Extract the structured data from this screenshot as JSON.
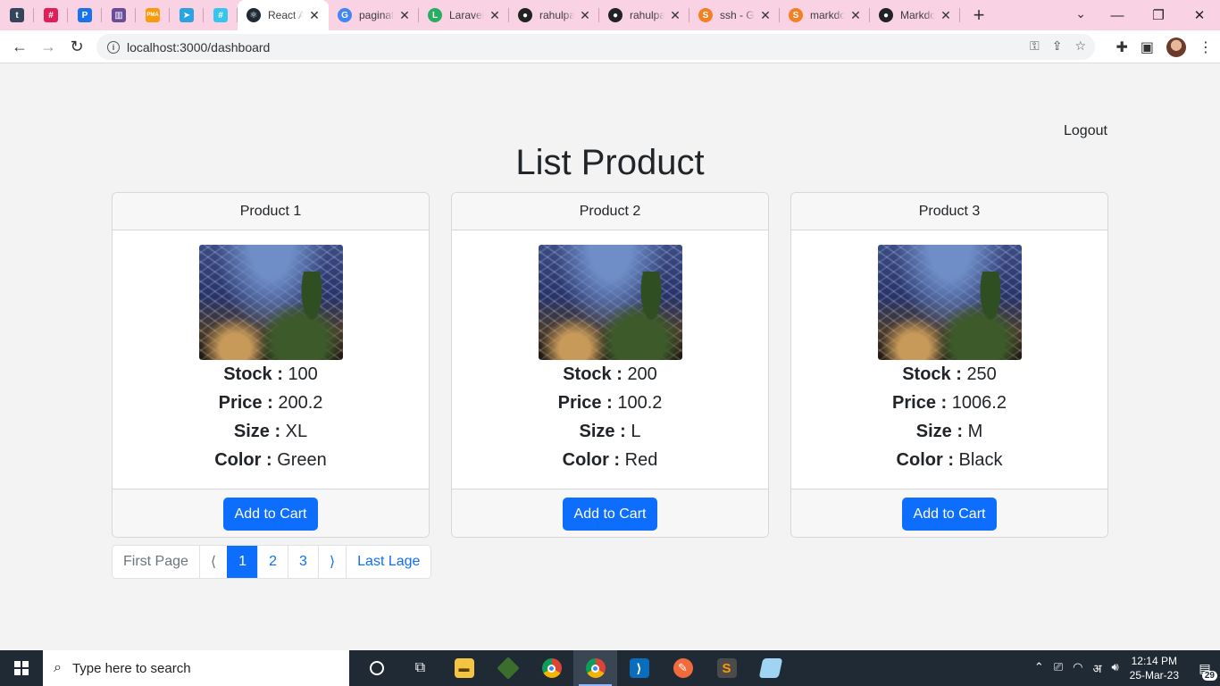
{
  "browser": {
    "pinned_tabs": [
      {
        "icon": "tumblr-icon",
        "glyph": "t",
        "color": "#35465c"
      },
      {
        "icon": "slack-icon",
        "glyph": "#",
        "color": "#e01e5a"
      },
      {
        "icon": "pocket-icon",
        "glyph": "P",
        "color": "#1a73e8"
      },
      {
        "icon": "trello-icon",
        "glyph": "▥",
        "color": "#6b4c9a"
      },
      {
        "icon": "phpmyadmin-icon",
        "glyph": "PMA",
        "color": "#f89c0e"
      },
      {
        "icon": "telegram-icon",
        "glyph": "➤",
        "color": "#2aa3e0"
      },
      {
        "icon": "slack-icon",
        "glyph": "#",
        "color": "#36c5f0"
      }
    ],
    "tabs": [
      {
        "title": "React App",
        "icon": "react-icon",
        "glyph": "⚛",
        "color": "#1f2a35",
        "active": true
      },
      {
        "title": "paginate",
        "icon": "google-icon",
        "glyph": "G",
        "color": "#4285f4"
      },
      {
        "title": "Laravel",
        "icon": "laravel-icon",
        "glyph": "L",
        "color": "#27ae60"
      },
      {
        "title": "rahulpa",
        "icon": "github-icon",
        "glyph": "●",
        "color": "#222222"
      },
      {
        "title": "rahulpa",
        "icon": "github-icon",
        "glyph": "●",
        "color": "#222222"
      },
      {
        "title": "ssh - G",
        "icon": "stackoverflow-icon",
        "glyph": "S",
        "color": "#f48024"
      },
      {
        "title": "markdo",
        "icon": "stackoverflow-icon",
        "glyph": "S",
        "color": "#f48024"
      },
      {
        "title": "Markdo",
        "icon": "github-icon",
        "glyph": "●",
        "color": "#222222"
      }
    ],
    "url": "localhost:3000/dashboard"
  },
  "header": {
    "logout_label": "Logout",
    "title": "List Product"
  },
  "products": [
    {
      "name": "Product 1",
      "stock_label": "Stock",
      "stock": "100",
      "price_label": "Price",
      "price": "200.2",
      "size_label": "Size",
      "size": "XL",
      "color_label": "Color",
      "color": "Green",
      "button": "Add to Cart"
    },
    {
      "name": "Product 2",
      "stock_label": "Stock",
      "stock": "200",
      "price_label": "Price",
      "price": "100.2",
      "size_label": "Size",
      "size": "L",
      "color_label": "Color",
      "color": "Red",
      "button": "Add to Cart"
    },
    {
      "name": "Product 3",
      "stock_label": "Stock",
      "stock": "250",
      "price_label": "Price",
      "price": "1006.2",
      "size_label": "Size",
      "size": "M",
      "color_label": "Color",
      "color": "Black",
      "button": "Add to Cart"
    }
  ],
  "pagination": {
    "first": "First Page",
    "prev": "⟨",
    "pages": [
      "1",
      "2",
      "3"
    ],
    "current": "1",
    "next": "⟩",
    "last": "Last Lage"
  },
  "taskbar": {
    "search_placeholder": "Type here to search",
    "time": "12:14 PM",
    "date": "25-Mar-23",
    "notification_count": "29",
    "lang": "अ"
  },
  "colors": {
    "primary": "#0d6efd",
    "tabstrip": "#f9d3e3",
    "taskbar": "#1f2a35"
  }
}
